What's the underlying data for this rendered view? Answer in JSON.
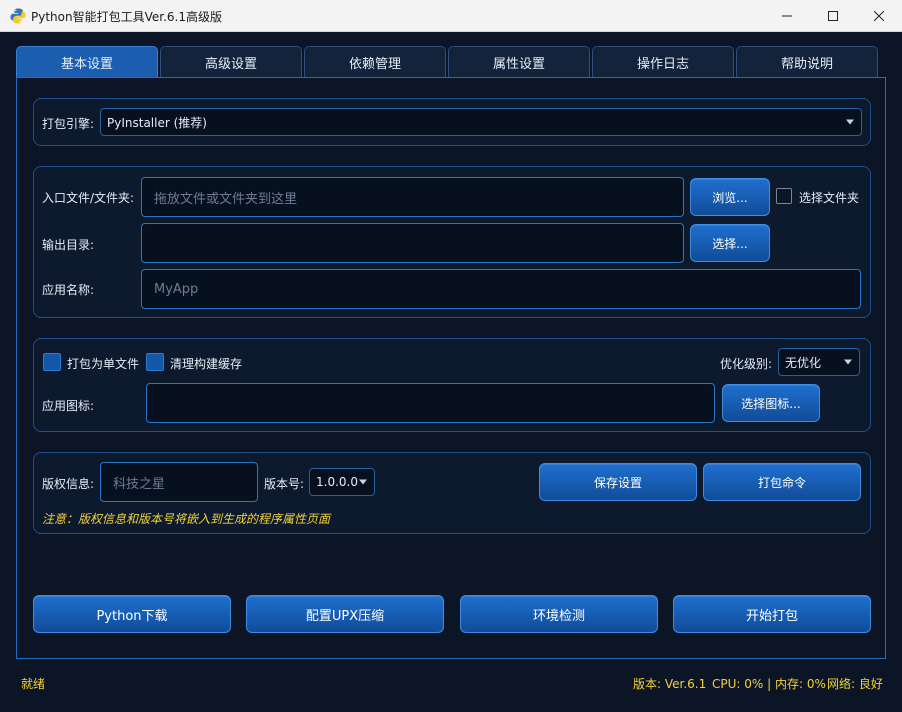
{
  "window": {
    "title": "Python智能打包工具Ver.6.1高级版",
    "icon": "python-logo-icon",
    "controls": [
      "minimize-icon",
      "maximize-icon",
      "close-icon"
    ]
  },
  "tabs": [
    {
      "label": "基本设置",
      "active": true
    },
    {
      "label": "高级设置",
      "active": false
    },
    {
      "label": "依赖管理",
      "active": false
    },
    {
      "label": "属性设置",
      "active": false
    },
    {
      "label": "操作日志",
      "active": false
    },
    {
      "label": "帮助说明",
      "active": false
    }
  ],
  "engine": {
    "label": "打包引擎:",
    "value": "PyInstaller (推荐)"
  },
  "paths": {
    "entry_label": "入口文件/文件夹:",
    "entry_placeholder": "拖放文件或文件夹到这里",
    "browse_label": "浏览...",
    "select_folder_label": "选择文件夹",
    "select_folder_checked": false,
    "output_label": "输出目录:",
    "output_value": "",
    "output_select_label": "选择...",
    "appname_label": "应用名称:",
    "appname_placeholder": "MyApp"
  },
  "options": {
    "onefile_label": "打包为单文件",
    "onefile_checked": true,
    "clean_label": "清理构建缓存",
    "clean_checked": true,
    "optimize_label": "优化级别:",
    "optimize_value": "无优化",
    "icon_label": "应用图标:",
    "icon_value": "",
    "icon_select_label": "选择图标..."
  },
  "meta": {
    "copyright_label": "版权信息:",
    "copyright_placeholder": "科技之星",
    "version_label": "版本号:",
    "version_value": "1.0.0.0",
    "save_label": "保存设置",
    "command_label": "打包命令",
    "note": "注意：版权信息和版本号将嵌入到生成的程序属性页面"
  },
  "actions": {
    "python_download": "Python下载",
    "upx_config": "配置UPX压缩",
    "env_check": "环境检测",
    "start_pack": "开始打包"
  },
  "status": {
    "state": "就绪",
    "version": "版本: Ver.6.1",
    "resources": "CPU: 0% | 内存: 0%",
    "network": "网络: 良好"
  },
  "colors": {
    "background": "#0b1526",
    "accent": "#1b5eb0",
    "status_text": "#f2d23a"
  }
}
